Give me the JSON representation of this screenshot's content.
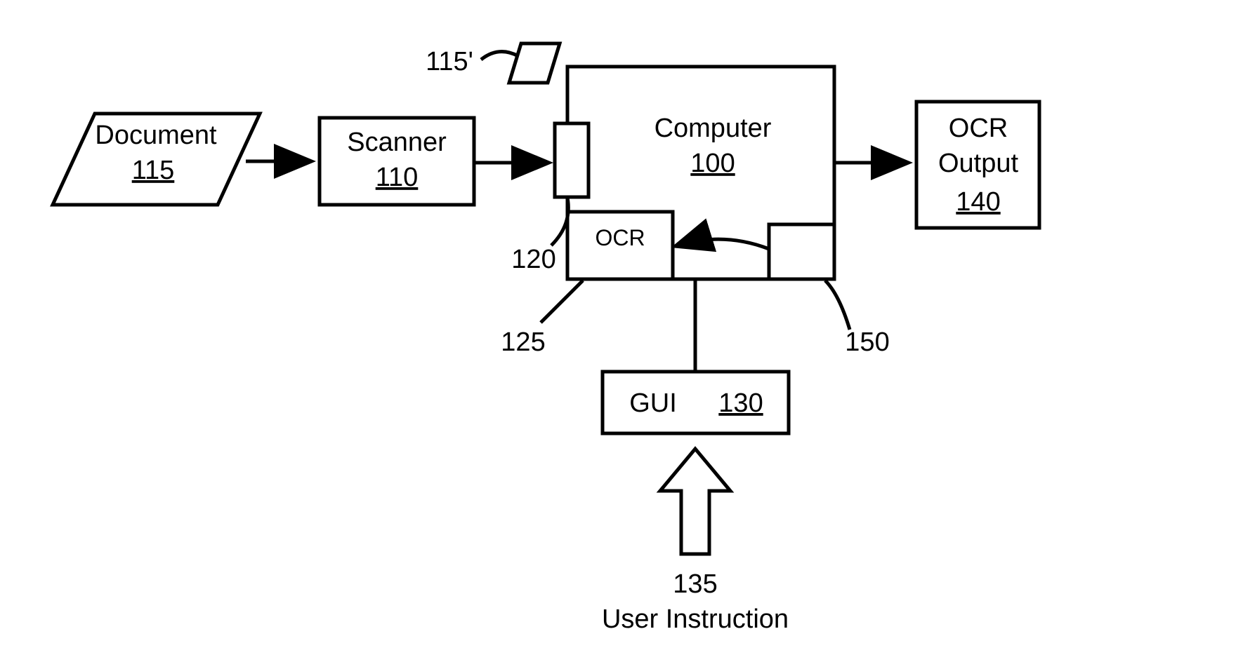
{
  "diagram": {
    "document": {
      "label": "Document",
      "ref": "115"
    },
    "scanner": {
      "label": "Scanner",
      "ref": "110"
    },
    "image_alt": {
      "ref": "115'"
    },
    "computer": {
      "label": "Computer",
      "ref": "100"
    },
    "input_port": {
      "ref": "120"
    },
    "ocr": {
      "label": "OCR",
      "ref": "125"
    },
    "sub_block": {
      "ref": "150"
    },
    "gui": {
      "label": "GUI",
      "ref": "130"
    },
    "user_instruction": {
      "ref": "135",
      "label": "User Instruction"
    },
    "output": {
      "label1": "OCR",
      "label2": "Output",
      "ref": "140"
    }
  }
}
